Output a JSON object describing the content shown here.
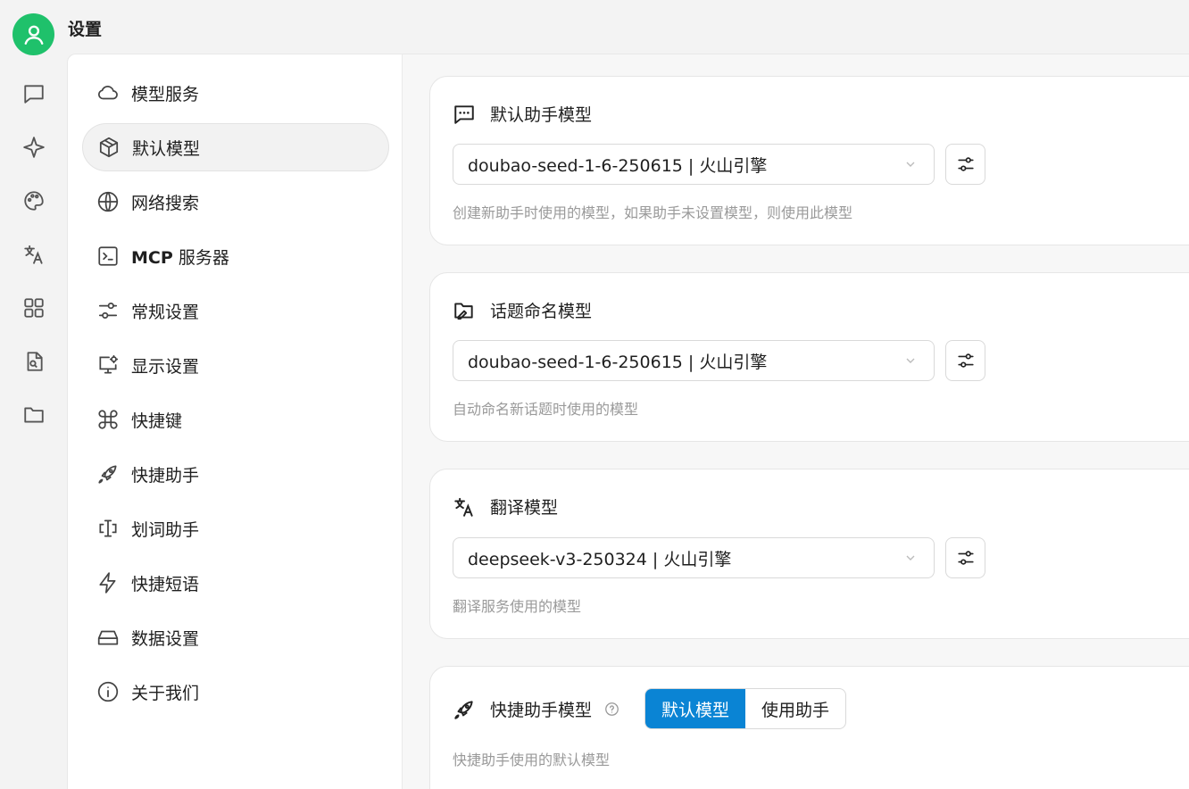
{
  "app": {
    "title": "设置"
  },
  "rail": {
    "items": [
      {
        "name": "chat-icon"
      },
      {
        "name": "sparkle-icon"
      },
      {
        "name": "palette-icon"
      },
      {
        "name": "translate-icon"
      },
      {
        "name": "apps-grid-icon"
      },
      {
        "name": "file-search-icon"
      },
      {
        "name": "folder-icon"
      }
    ]
  },
  "nav": {
    "items": [
      {
        "label": "模型服务",
        "icon": "cloud-icon"
      },
      {
        "label": "默认模型",
        "icon": "cube-icon",
        "active": true
      },
      {
        "label": "网络搜索",
        "icon": "globe-icon"
      },
      {
        "label_bold": "MCP",
        "label": " 服务器",
        "icon": "terminal-icon"
      },
      {
        "label": "常规设置",
        "icon": "sliders-icon"
      },
      {
        "label": "显示设置",
        "icon": "monitor-settings-icon"
      },
      {
        "label": "快捷键",
        "icon": "command-icon"
      },
      {
        "label": "快捷助手",
        "icon": "rocket-icon"
      },
      {
        "label": "划词助手",
        "icon": "text-cursor-icon"
      },
      {
        "label": "快捷短语",
        "icon": "lightning-icon"
      },
      {
        "label": "数据设置",
        "icon": "hard-drive-icon"
      },
      {
        "label": "关于我们",
        "icon": "info-icon"
      }
    ]
  },
  "cards": {
    "default_assistant": {
      "title": "默认助手模型",
      "selected": "doubao-seed-1-6-250615 | 火山引擎",
      "hint": "创建新助手时使用的模型，如果助手未设置模型，则使用此模型"
    },
    "topic_naming": {
      "title": "话题命名模型",
      "selected": "doubao-seed-1-6-250615 | 火山引擎",
      "hint": "自动命名新话题时使用的模型"
    },
    "translate": {
      "title": "翻译模型",
      "selected": "deepseek-v3-250324 | 火山引擎",
      "hint": "翻译服务使用的模型"
    },
    "quick_assistant": {
      "title": "快捷助手模型",
      "options": [
        "默认模型",
        "使用助手"
      ],
      "selected_option": "默认模型",
      "hint": "快捷助手使用的默认模型"
    }
  },
  "colors": {
    "accent": "#0a84d4",
    "avatar": "#1fc16b"
  }
}
